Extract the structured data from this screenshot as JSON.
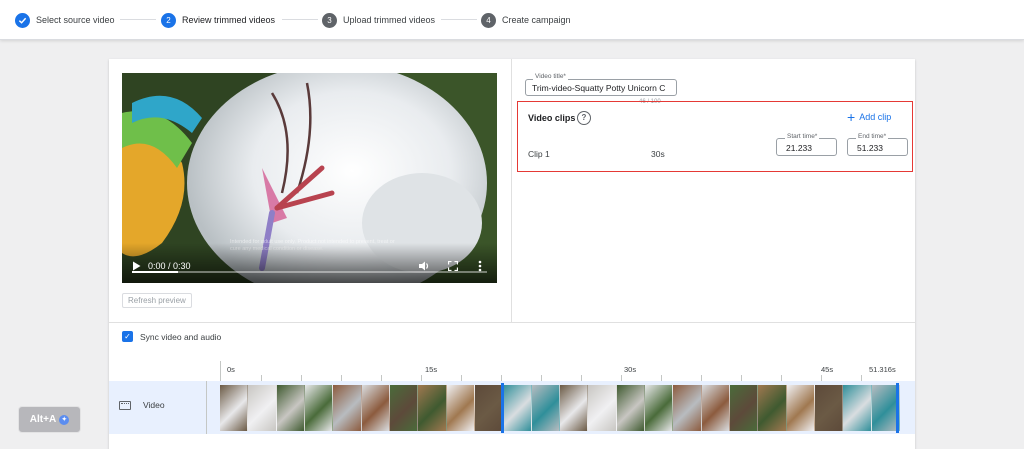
{
  "stepper": {
    "steps": [
      {
        "number": "",
        "label": "Select source video",
        "state": "complete"
      },
      {
        "number": "2",
        "label": "Review trimmed videos",
        "state": "active"
      },
      {
        "number": "3",
        "label": "Upload trimmed videos",
        "state": "pending"
      },
      {
        "number": "4",
        "label": "Create campaign",
        "state": "pending"
      }
    ]
  },
  "player": {
    "time": "0:00 / 0:30",
    "progress_fraction": 0.13,
    "disclaimer": "Intended for adult use only. Product not intended to prevent, treat or cure any medical condition or disease.",
    "refresh_label": "Refresh preview"
  },
  "video_title": {
    "label": "Video title*",
    "value": "Trim-video-Squatty Potty Unicorn C",
    "counter": "46 / 100"
  },
  "clips": {
    "heading": "Video clips",
    "help_glyph": "?",
    "add_label": "Add clip",
    "items": [
      {
        "name": "Clip 1",
        "duration": "30s",
        "start_label": "Start time*",
        "start_value": "21.233",
        "end_label": "End time*",
        "end_value": "51.233"
      }
    ]
  },
  "sync": {
    "label": "Sync video and audio",
    "checked": true
  },
  "timeline": {
    "ticks": [
      "0s",
      "15s",
      "30s",
      "45s",
      "51.316s"
    ],
    "track_label": "Video",
    "total_seconds": 51.316,
    "selection_start": 21.233,
    "selection_end": 51.233
  },
  "badge": {
    "text": "Alt+A",
    "dot": "✦"
  },
  "colors": {
    "accent": "#1a73e8",
    "highlight_border": "#e53935"
  }
}
